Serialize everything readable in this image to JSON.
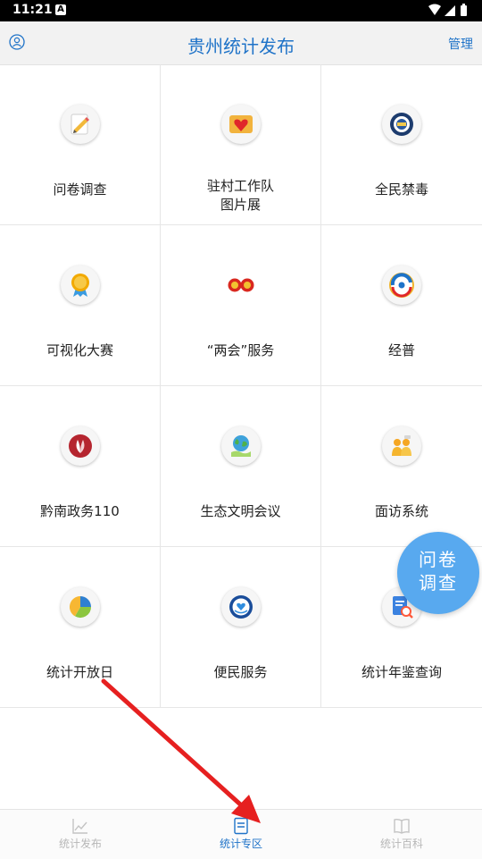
{
  "status_bar": {
    "time": "11:21",
    "indicator": "A"
  },
  "header": {
    "title": "贵州统计发布",
    "manage_label": "管理"
  },
  "tiles": [
    {
      "label": "问卷调查",
      "icon": "pencil-note-icon"
    },
    {
      "label": "驻村工作队\n图片展",
      "icon": "heart-card-icon"
    },
    {
      "label": "全民禁毒",
      "icon": "anti-drug-emblem-icon"
    },
    {
      "label": "可视化大赛",
      "icon": "award-medal-icon"
    },
    {
      "label": "“两会”服务",
      "icon": "national-emblems-icon"
    },
    {
      "label": "经普",
      "icon": "census-logo-icon"
    },
    {
      "label": "黔南政务110",
      "icon": "leaf-emblem-icon"
    },
    {
      "label": "生态文明会议",
      "icon": "globe-hand-icon"
    },
    {
      "label": "面访系统",
      "icon": "interview-people-icon"
    },
    {
      "label": "统计开放日",
      "icon": "pie-chart-icon"
    },
    {
      "label": "便民服务",
      "icon": "service-badge-icon"
    },
    {
      "label": "统计年鉴查询",
      "icon": "document-search-icon"
    }
  ],
  "fab": {
    "line1": "问卷",
    "line2": "调查"
  },
  "bottom_nav": [
    {
      "label": "统计发布",
      "icon": "line-chart-icon",
      "active": false
    },
    {
      "label": "统计专区",
      "icon": "document-list-icon",
      "active": true
    },
    {
      "label": "统计百科",
      "icon": "open-book-icon",
      "active": false
    }
  ],
  "colors": {
    "brand_blue": "#1f73c8",
    "fab_blue": "#58a9ef",
    "inactive_nav": "#b7b7b7",
    "annotation_red": "#e62020"
  }
}
